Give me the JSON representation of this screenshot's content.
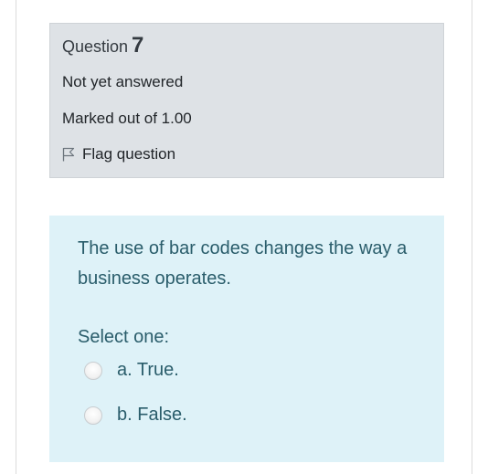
{
  "info": {
    "question_label": "Question",
    "question_number": "7",
    "state": "Not yet answered",
    "grade": "Marked out of 1.00",
    "flag_label": "Flag question"
  },
  "question": {
    "text": "The use of bar codes changes the way a business operates.",
    "prompt": "Select one:",
    "options": [
      {
        "label": "a. True.",
        "selected": false
      },
      {
        "label": "b. False.",
        "selected": false
      }
    ]
  },
  "colors": {
    "info_bg": "#dee2e6",
    "content_bg": "#def2f8",
    "content_text": "#2a5d6b"
  }
}
